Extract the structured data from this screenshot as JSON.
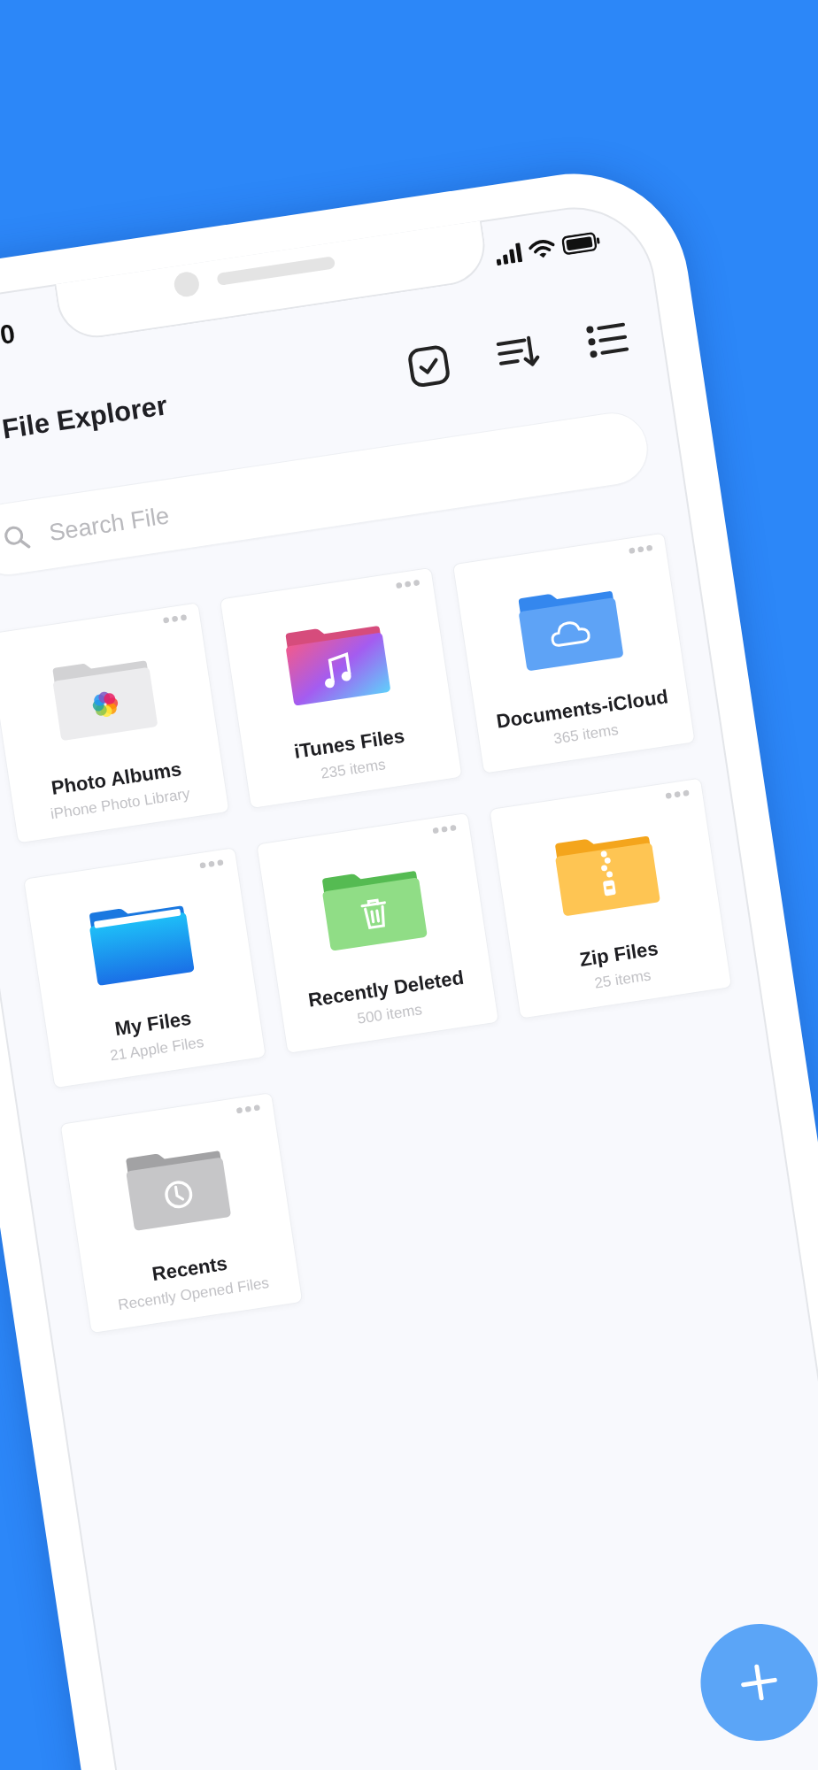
{
  "status_bar": {
    "time": "0"
  },
  "header": {
    "title": "File Explorer"
  },
  "search": {
    "placeholder": "Search File"
  },
  "folders": [
    {
      "kind": "photos",
      "title": "Photo Albums",
      "subtitle": "iPhone Photo Library"
    },
    {
      "kind": "music",
      "title": "iTunes Files",
      "subtitle": "235 items"
    },
    {
      "kind": "cloud",
      "title": "Documents-iCloud",
      "subtitle": "365 items"
    },
    {
      "kind": "files",
      "title": "My Files",
      "subtitle": "21 Apple Files"
    },
    {
      "kind": "trash",
      "title": "Recently Deleted",
      "subtitle": "500 items"
    },
    {
      "kind": "zip",
      "title": "Zip Files",
      "subtitle": "25 items"
    },
    {
      "kind": "recent",
      "title": "Recents",
      "subtitle": "Recently Opened Files"
    }
  ]
}
